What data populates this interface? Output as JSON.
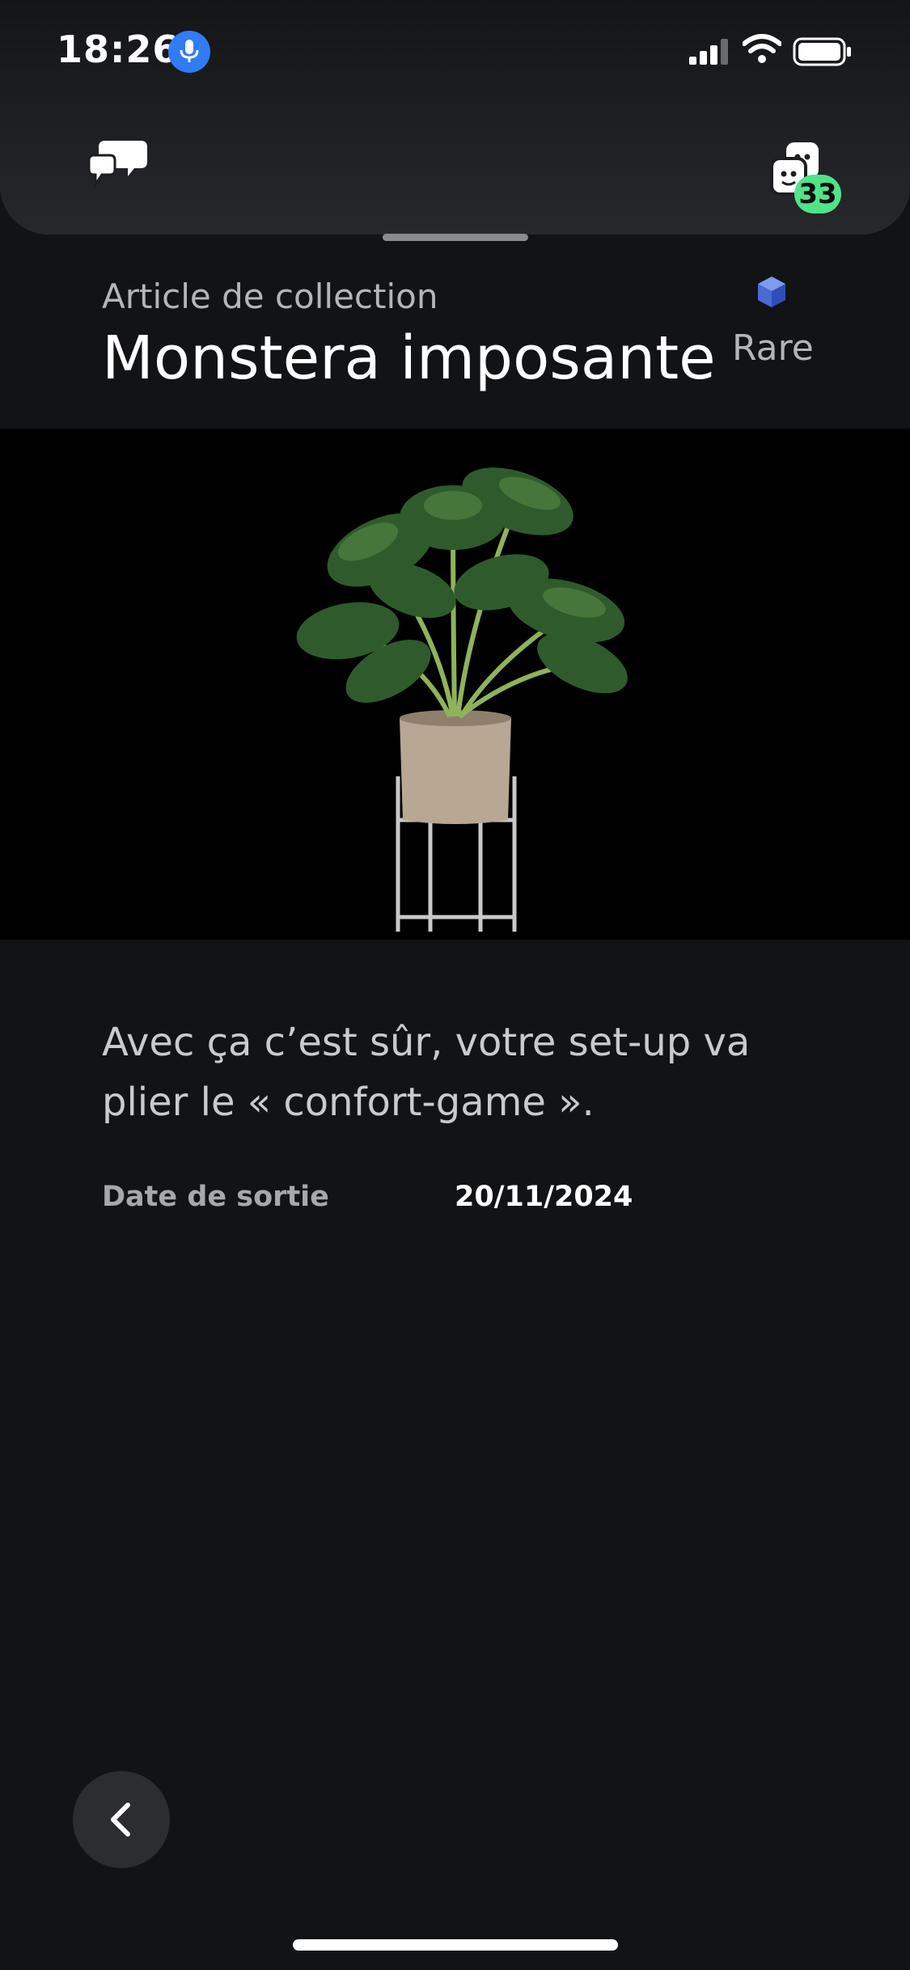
{
  "status_bar": {
    "time": "18:26",
    "icons": [
      "microphone-icon",
      "cellular-signal-icon",
      "wifi-icon",
      "battery-icon"
    ]
  },
  "header": {
    "chat_icon": "chat-bubbles-icon",
    "friends_icon": "friends-icon",
    "friends_badge": "33"
  },
  "item": {
    "kicker": "Article de collection",
    "name": "Monstera imposante",
    "rarity": "Rare",
    "rarity_icon": "cube-icon",
    "image": "monstera-plant-in-pot-on-stand",
    "description": "Avec ça c’est sûr, votre set-up va plier le « confort-game ».",
    "release_label": "Date de sortie",
    "release_date": "20/11/2024"
  },
  "nav": {
    "back_icon": "chevron-left-icon"
  },
  "colors": {
    "background": "#121315",
    "badge": "#4fe38a",
    "mic_pill": "#2f7cf6",
    "rarity": "#4a6bd6"
  }
}
